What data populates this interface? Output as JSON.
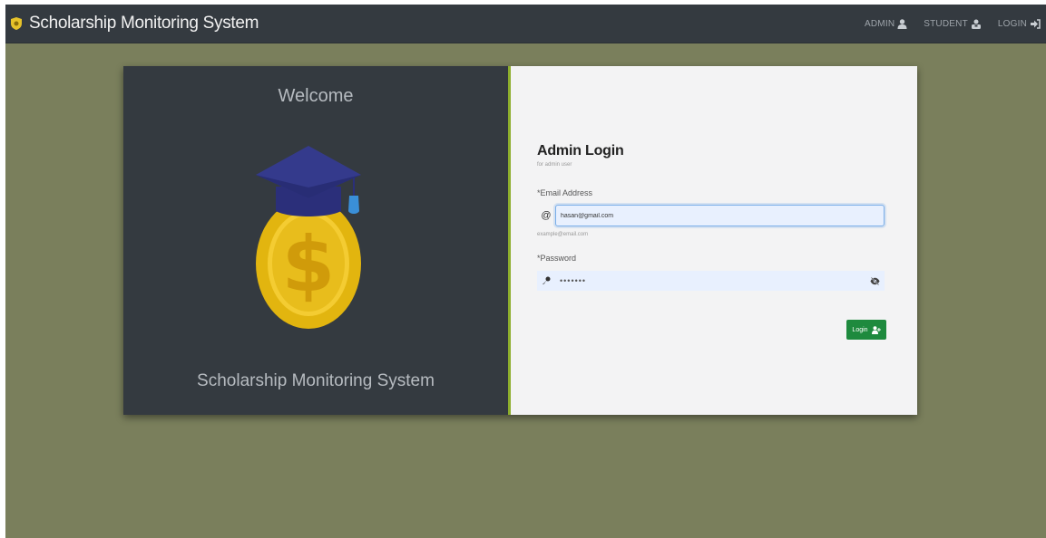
{
  "navbar": {
    "brand": "Scholarship Monitoring System",
    "links": [
      {
        "label": "ADMIN",
        "icon": "user-icon"
      },
      {
        "label": "STUDENT",
        "icon": "student-icon"
      },
      {
        "label": "LOGIN",
        "icon": "sign-in-icon"
      }
    ]
  },
  "left_panel": {
    "welcome": "Welcome",
    "title": "Scholarship Monitoring System",
    "logo_icon": "graduation-coin-icon"
  },
  "login": {
    "title": "Admin Login",
    "subtitle": "for admin user",
    "email_label": "*Email Address",
    "email_value": "hasan@gmail.com",
    "email_icon": "at-icon",
    "email_help": "example@email.com",
    "password_label": "*Password",
    "password_value": "•••••••",
    "password_icon": "key-icon",
    "toggle_icon": "eye-slash-icon",
    "button_label": "Login",
    "button_icon": "user-plus-icon"
  },
  "colors": {
    "background": "#7a7f5c",
    "navbar": "#343a40",
    "accent": "#8dae2d",
    "button": "#1e8a3e"
  }
}
